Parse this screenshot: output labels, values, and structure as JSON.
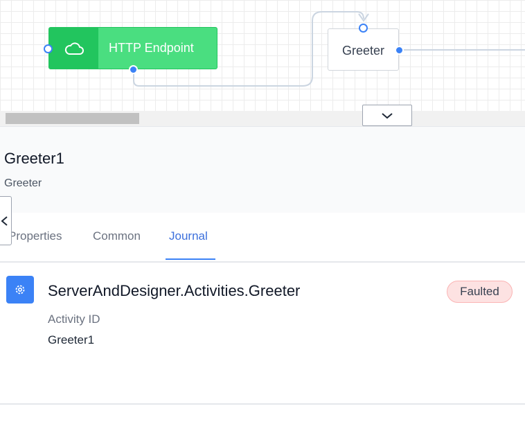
{
  "designer": {
    "nodes": [
      {
        "label": "HTTP Endpoint",
        "icon": "cloud-icon",
        "color": "#4ade80"
      },
      {
        "label": "Greeter"
      }
    ],
    "expand_icon": "chevron-down-icon"
  },
  "panel": {
    "title": "Greeter1",
    "subtitle": "Greeter",
    "collapse_icon": "chevron-left-icon"
  },
  "tabs": [
    {
      "label": "Properties",
      "active": false
    },
    {
      "label": "Common",
      "active": false
    },
    {
      "label": "Journal",
      "active": true
    }
  ],
  "journal": {
    "entry": {
      "icon": "gear-icon",
      "title": "ServerAndDesigner.Activities.Greeter",
      "status": "Faulted",
      "status_color": "#fde2e2",
      "fields": [
        {
          "label": "Activity ID",
          "value": "Greeter1"
        }
      ]
    }
  },
  "accent": "#3b82f6"
}
